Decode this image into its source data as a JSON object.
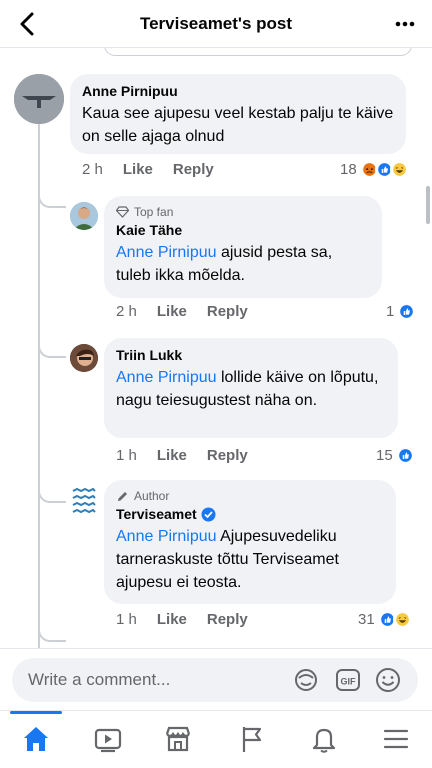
{
  "header": {
    "title": "Terviseamet's post"
  },
  "comments": [
    {
      "author": "Anne Pirnipuu",
      "text": "Kaua see ajupesu veel kestab palju te käive on selle ajaga olnud",
      "time": "2 h",
      "like": "Like",
      "reply": "Reply",
      "reactions": "18",
      "reaction_icons": [
        "angry-react-icon",
        "like-react-icon",
        "haha-react-icon"
      ]
    }
  ],
  "replies": [
    {
      "badge": "Top fan",
      "author": "Kaie Tähe",
      "mention": "Anne Pirnipuu",
      "text": " ajusid pesta sa, tuleb ikka mõelda.",
      "time": "2 h",
      "like": "Like",
      "reply": "Reply",
      "reactions": "1",
      "reaction_icons": [
        "like-react-icon"
      ]
    },
    {
      "badge": "",
      "author": "Triin Lukk",
      "mention": "Anne Pirnipuu",
      "text": " lollide käive on lõputu, nagu teiesugustest näha on.",
      "time": "1 h",
      "like": "Like",
      "reply": "Reply",
      "reactions": "15",
      "reaction_icons": [
        "like-react-icon"
      ]
    },
    {
      "badge": "Author",
      "author": "Terviseamet",
      "verified": true,
      "mention": "Anne Pirnipuu",
      "text": " Ajupesuvedeliku tarneraskuste tõttu Terviseamet ajupesu ei teosta.",
      "time": "1 h",
      "like": "Like",
      "reply": "Reply",
      "reactions": "31",
      "reaction_icons": [
        "like-react-icon",
        "haha-react-icon"
      ]
    }
  ],
  "composer": {
    "placeholder": "Write a comment..."
  },
  "nav": {
    "items": [
      "home-icon",
      "watch-icon",
      "marketplace-icon",
      "pages-flag-icon",
      "notifications-bell-icon",
      "menu-icon"
    ],
    "active": "home-icon"
  },
  "colors": {
    "accent": "#1877f2",
    "bubble": "#f0f2f5",
    "secondary_text": "#65676b"
  }
}
